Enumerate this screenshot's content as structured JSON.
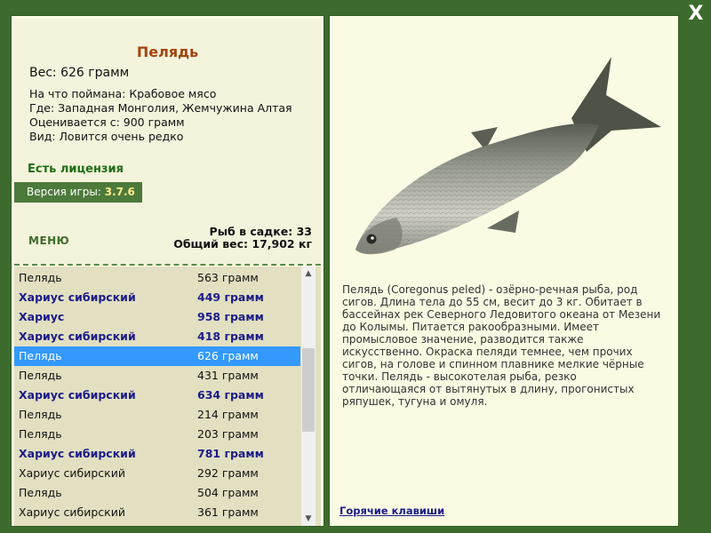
{
  "window": {
    "close_label": "X"
  },
  "fish": {
    "name": "Пелядь",
    "weight": "Вес: 626 грамм",
    "details": [
      "На что поймана: Крабовое мясо",
      "Где: Западная Монголия, Жемчужина Алтая",
      "Оценивается с: 900 грамм",
      "Вид: Ловится очень редко"
    ],
    "description": "Пелядь (Coregonus peled) - озёрно-речная рыба, род сигов. Длина тела до 55 см, весит до 3 кг. Обитает в бассейнах рек Северного Ледовитого океана от Мезени до Колымы. Питается ракообразными. Имеет промысловое значение, разводится также искусственно. Окраска пеляди темнее, чем прочих сигов, на голове и спинном плавнике мелкие чёрные точки. Пелядь - высокотелая рыба, резко отличающаяся от вытянутых в длину, прогонистых ряпушек, тугуна и омуля."
  },
  "license": "Есть лицензия",
  "version": {
    "label": "Версия игры:",
    "value": "3.7.6"
  },
  "menu_label": "МЕНЮ",
  "cage": {
    "count": "Рыб в садке: 33",
    "total": "Общий вес: 17,902 кг"
  },
  "catch_list": [
    {
      "name": "Пелядь",
      "weight": "563 грамм",
      "bold": false,
      "selected": false
    },
    {
      "name": "Хариус сибирский",
      "weight": "449 грамм",
      "bold": true,
      "selected": false
    },
    {
      "name": "Хариус",
      "weight": "958 грамм",
      "bold": true,
      "selected": false
    },
    {
      "name": "Хариус сибирский",
      "weight": "418 грамм",
      "bold": true,
      "selected": false
    },
    {
      "name": "Пелядь",
      "weight": "626 грамм",
      "bold": false,
      "selected": true
    },
    {
      "name": "Пелядь",
      "weight": "431 грамм",
      "bold": false,
      "selected": false
    },
    {
      "name": "Хариус сибирский",
      "weight": "634 грамм",
      "bold": true,
      "selected": false
    },
    {
      "name": "Пелядь",
      "weight": "214 грамм",
      "bold": false,
      "selected": false
    },
    {
      "name": "Пелядь",
      "weight": "203 грамм",
      "bold": false,
      "selected": false
    },
    {
      "name": "Хариус сибирский",
      "weight": "781 грамм",
      "bold": true,
      "selected": false
    },
    {
      "name": "Хариус сибирский",
      "weight": "292 грамм",
      "bold": false,
      "selected": false
    },
    {
      "name": "Пелядь",
      "weight": "504 грамм",
      "bold": false,
      "selected": false
    },
    {
      "name": "Хариус сибирский",
      "weight": "361 грамм",
      "bold": false,
      "selected": false
    }
  ],
  "hotkeys_label": "Горячие клавиши",
  "icons": {
    "close": "close-icon",
    "scroll_up": "chevron-up-icon",
    "scroll_down": "chevron-down-icon",
    "fish_image": "fish-image"
  },
  "colors": {
    "background": "#3d6b2e",
    "panel": "#fbfbe3",
    "title": "#a2450e",
    "license": "#1e6d16",
    "bold_fish": "#1b1b8a",
    "selection": "#3399ff"
  }
}
